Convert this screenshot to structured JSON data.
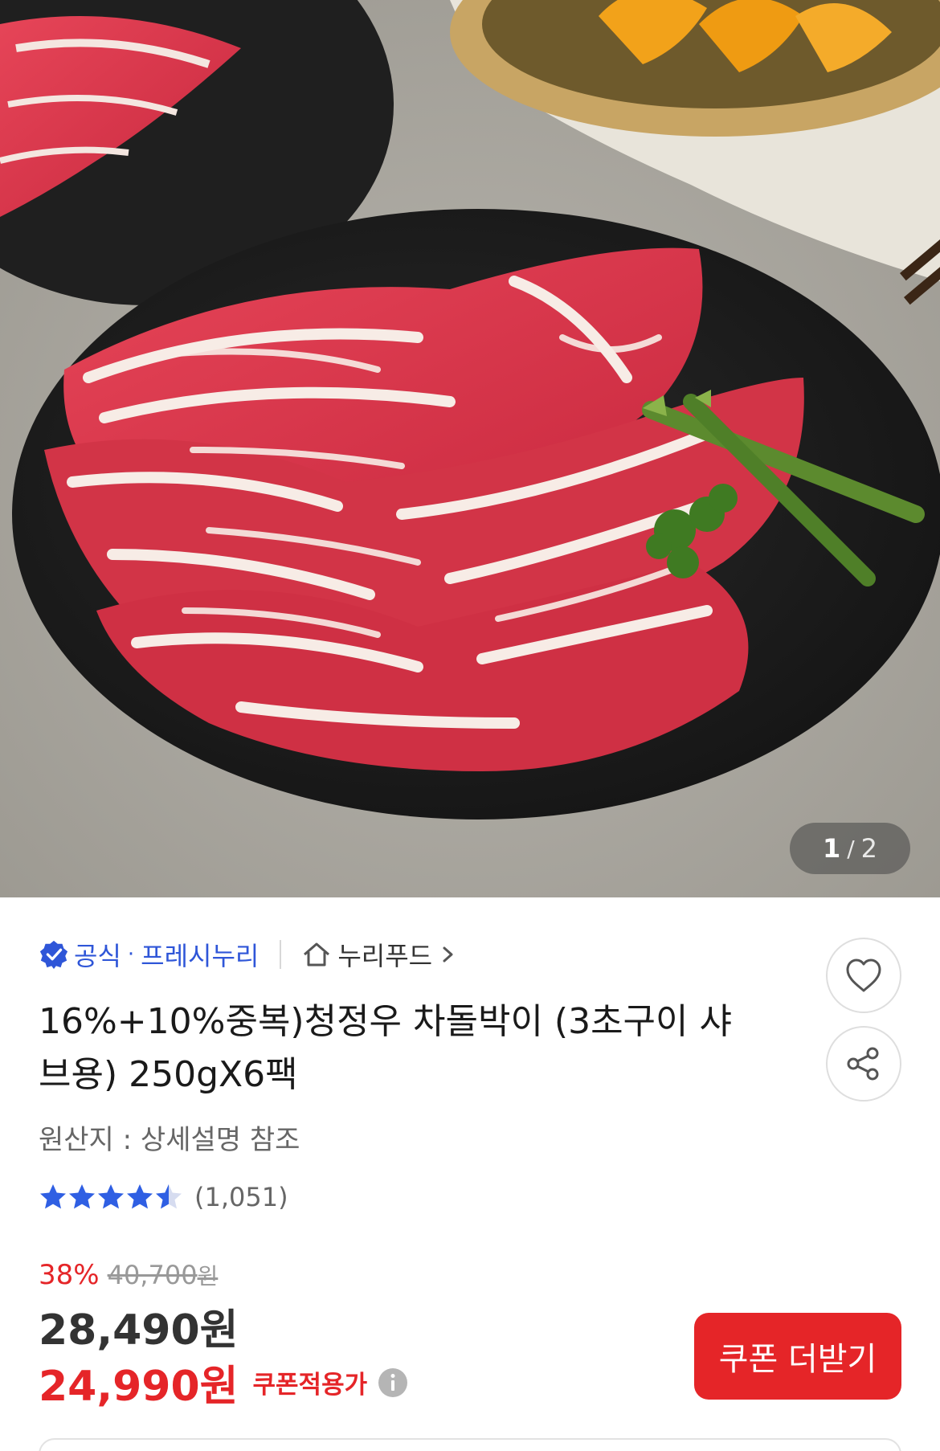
{
  "gallery": {
    "current": "1",
    "separator": "/",
    "total": "2"
  },
  "seller": {
    "official_label": "공식",
    "dot": "·",
    "brand": "프레시누리",
    "store_name": "누리푸드"
  },
  "product": {
    "title": "16%+10%중복)청정우 차돌박이 (3초구이 샤브용) 250gX6팩",
    "origin": "원산지 : 상세설명 참조"
  },
  "rating": {
    "stars": 4.5,
    "count": "(1,051)"
  },
  "price": {
    "discount_rate": "38%",
    "original": "40,700",
    "original_unit": "원",
    "sale": "28,490원",
    "coupon_price": "24,990원",
    "coupon_label": "쿠폰적용가"
  },
  "actions": {
    "coupon_button": "쿠폰 더받기"
  },
  "colors": {
    "accent_red": "#e52528",
    "official_blue": "#2f56d8",
    "star_blue": "#2f5fe3"
  },
  "icons": [
    "verified-badge-icon",
    "home-icon",
    "chevron-right-icon",
    "heart-icon",
    "share-icon",
    "star-icon",
    "info-icon"
  ]
}
